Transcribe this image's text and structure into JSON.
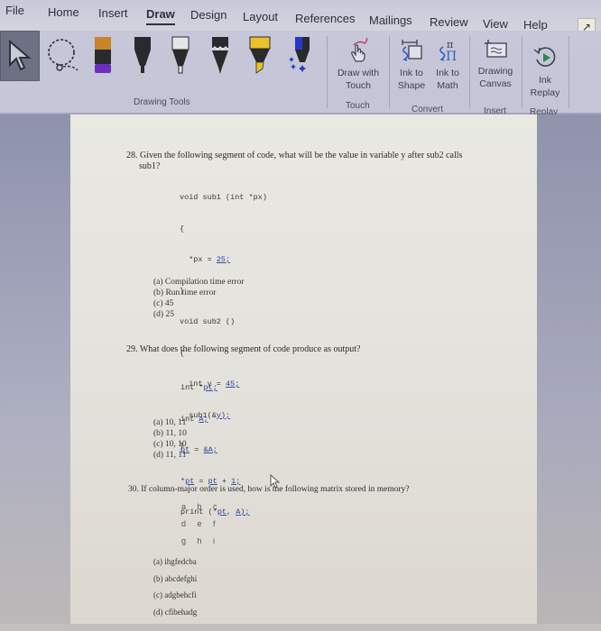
{
  "ribbon": {
    "tabs": [
      {
        "label": "File"
      },
      {
        "label": "Home"
      },
      {
        "label": "Insert"
      },
      {
        "label": "Draw",
        "active": true
      },
      {
        "label": "Design"
      },
      {
        "label": "Layout"
      },
      {
        "label": "References"
      },
      {
        "label": "Mailings"
      },
      {
        "label": "Review"
      },
      {
        "label": "View"
      },
      {
        "label": "Help"
      }
    ],
    "share_icon": "share-icon",
    "drawing_tools": {
      "group_label": "Drawing Tools",
      "tools": [
        {
          "name": "select-tool",
          "icon": "arrow-cursor-icon"
        },
        {
          "name": "lasso-select",
          "icon": "lasso-icon"
        },
        {
          "name": "eraser",
          "icon": "eraser-icon",
          "colors": [
            "#c9832a",
            "#2a2a2e",
            "#6c2fc0"
          ]
        },
        {
          "name": "pen-black",
          "icon": "pen-icon",
          "color": "#2a2a2e"
        },
        {
          "name": "pen-white",
          "icon": "pen-icon",
          "color": "#e6e6e6"
        },
        {
          "name": "pen-black-galaxy",
          "icon": "pen-icon",
          "color": "#2a2a2e"
        },
        {
          "name": "highlighter-yellow",
          "icon": "highlighter-icon",
          "color": "#e8c228"
        },
        {
          "name": "pen-blue-galaxy",
          "icon": "sparkle-pen-icon",
          "color": "#2a36c8"
        }
      ]
    },
    "groups": [
      {
        "label": "Touch",
        "buttons": [
          {
            "label1": "Draw with",
            "label2": "Touch",
            "icon": "touch-hand-icon"
          }
        ]
      },
      {
        "label": "Convert",
        "buttons": [
          {
            "label1": "Ink to",
            "label2": "Shape",
            "icon": "ink-to-shape-icon"
          },
          {
            "label1": "Ink to",
            "label2": "Math",
            "icon": "ink-to-math-icon"
          }
        ]
      },
      {
        "label": "Insert",
        "buttons": [
          {
            "label1": "Drawing",
            "label2": "Canvas",
            "icon": "drawing-canvas-icon"
          }
        ]
      },
      {
        "label": "Replay",
        "buttons": [
          {
            "label1": "Ink",
            "label2": "Replay",
            "icon": "replay-icon"
          }
        ]
      }
    ]
  },
  "document": {
    "q28": {
      "line1": "28. Given the following segment of code, what will be the value in variable y after sub2 calls",
      "line2": "sub1?",
      "code": [
        {
          "pre": "void sub1 (int *px)",
          "u": "",
          "post": ""
        },
        {
          "pre": "{",
          "u": "",
          "post": ""
        },
        {
          "pre": "  *px = ",
          "u": "25;",
          "post": ""
        },
        {
          "pre": "}",
          "u": "",
          "post": ""
        },
        {
          "pre": "void sub2 ()",
          "u": "",
          "post": ""
        },
        {
          "pre": "{",
          "u": "",
          "post": ""
        },
        {
          "pre": "  int y = ",
          "u": "45;",
          "post": ""
        },
        {
          "pre": "  sub1(&",
          "u": "y);",
          "post": ""
        },
        {
          "pre": "}",
          "u": "",
          "post": ""
        }
      ],
      "options": [
        "(a) Compilation time error",
        "(b) Run time error",
        "(c) 45",
        "(d) 25"
      ]
    },
    "q29": {
      "line1": "29. What does the following segment of code produce as output?",
      "code": [
        {
          "pre": "int *",
          "u": "pt;",
          "post": ""
        },
        {
          "pre": "int ",
          "u": "A;",
          "post": ""
        },
        {
          "pre": "",
          "u": "pt",
          "post": " = ",
          "u2": "&A;"
        },
        {
          "pre": "*",
          "u": "pt",
          "post": " = ",
          "u2": "pt",
          "post2": " + ",
          "u3": "1;"
        },
        {
          "pre": "print (*",
          "u": "pt",
          "post": ", ",
          "u2": "A);"
        }
      ],
      "options": [
        "(a) 10, 11",
        "(b) 11, 10",
        "(c) 10, 10",
        "(d) 11, 11"
      ]
    },
    "q30": {
      "line1": "30. If column-major order is used, how is the following matrix stored in memory?",
      "matrix": [
        "a b c",
        "d e f",
        "g h i"
      ],
      "options": [
        "(a) ihgfedcba",
        "(b) abcdefghi",
        "(c) adgbehcfi",
        "(d) cfibehadg"
      ]
    }
  }
}
